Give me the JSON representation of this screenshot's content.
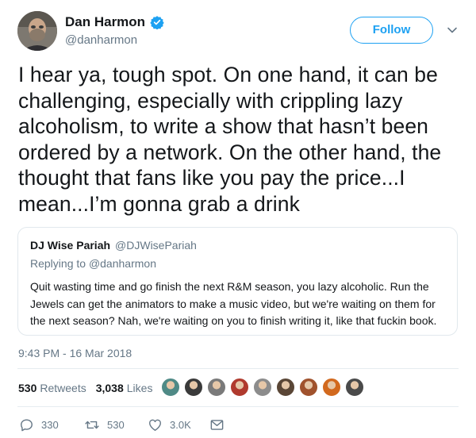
{
  "author": {
    "name": "Dan Harmon",
    "handle": "@danharmon",
    "verified": true,
    "avatar_icon": "profile-photo"
  },
  "follow_label": "Follow",
  "tweet_text": "I hear ya, tough spot. On one hand, it can be challenging, especially with crippling lazy alcoholism, to write a show that hasn’t been ordered by a network. On the other hand, the thought that fans like you pay the price...I mean...I’m gonna grab a drink",
  "quoted": {
    "name": "DJ Wise Pariah",
    "handle": "@DJWisePariah",
    "replying_to_prefix": "Replying to",
    "replying_to": "@danharmon",
    "text": "Quit wasting time and go finish the next R&M season, you lazy alcoholic. Run the Jewels can get the animators to make a music video, but we're waiting on them for the next season? Nah, we're waiting on you to finish writing it, like that fuckin book."
  },
  "timestamp": "9:43 PM - 16 Mar 2018",
  "stats": {
    "retweets_count": "530",
    "retweets_label": "Retweets",
    "likes_count": "3,038",
    "likes_label": "Likes",
    "likers": [
      {
        "icon": "liker-avatar",
        "color": "#4f8a86"
      },
      {
        "icon": "liker-avatar",
        "color": "#3a3a3a"
      },
      {
        "icon": "liker-avatar",
        "color": "#7a7a7a"
      },
      {
        "icon": "liker-avatar",
        "color": "#b03a2e"
      },
      {
        "icon": "liker-avatar",
        "color": "#8c8c8c"
      },
      {
        "icon": "liker-avatar",
        "color": "#5a4636"
      },
      {
        "icon": "liker-avatar",
        "color": "#a0522d"
      },
      {
        "icon": "liker-avatar",
        "color": "#d2691e"
      },
      {
        "icon": "liker-avatar",
        "color": "#4a4a4a"
      }
    ]
  },
  "actions": {
    "reply_count": "330",
    "retweet_count": "530",
    "like_count": "3.0K"
  },
  "colors": {
    "accent": "#1da1f2",
    "secondary_text": "#657786",
    "border": "#e1e8ed"
  }
}
